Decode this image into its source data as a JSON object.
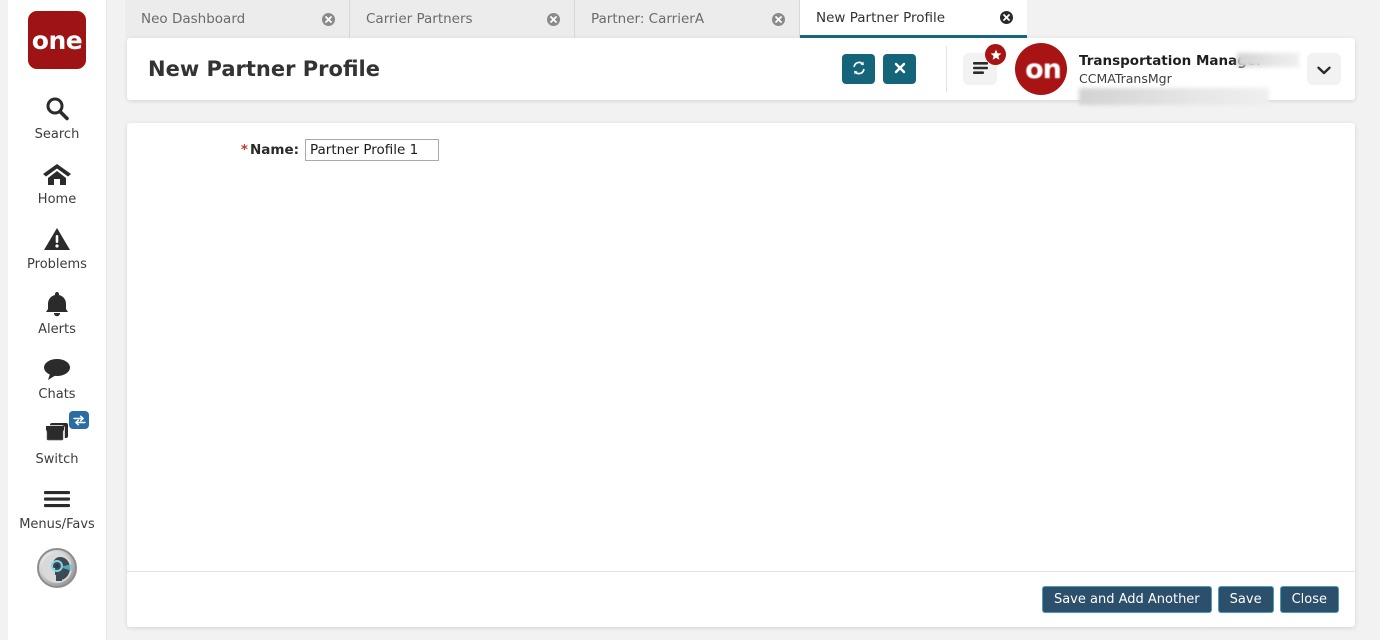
{
  "brand": {
    "logo_text": "one",
    "logo_color": "#9e1313",
    "accent_teal": "#15657a",
    "button_navy": "#2c4f6b",
    "button_border": "#49a0b5"
  },
  "sidebar": {
    "items": [
      {
        "label": "Search",
        "icon": "search-icon"
      },
      {
        "label": "Home",
        "icon": "home-icon"
      },
      {
        "label": "Problems",
        "icon": "warning-triangle-icon"
      },
      {
        "label": "Alerts",
        "icon": "bell-icon"
      },
      {
        "label": "Chats",
        "icon": "chat-bubble-icon"
      },
      {
        "label": "Switch",
        "icon": "windows-stack-icon",
        "badge_icon": "swap-arrows-icon"
      },
      {
        "label": "Menus/Favs",
        "icon": "hamburger-icon"
      }
    ],
    "assistant_icon": "ai-assistant-avatar-icon"
  },
  "tabs": [
    {
      "label": "Neo Dashboard",
      "active": false,
      "close_icon": "close-circle-icon"
    },
    {
      "label": "Carrier Partners",
      "active": false,
      "close_icon": "close-circle-icon"
    },
    {
      "label": "Partner: CarrierA",
      "active": false,
      "close_icon": "close-circle-icon"
    },
    {
      "label": "New Partner Profile",
      "active": true,
      "close_icon": "close-circle-icon"
    }
  ],
  "header": {
    "title": "New Partner Profile",
    "refresh_icon": "refresh-icon",
    "close_icon": "x-icon",
    "menu_icon": "hamburger-icon",
    "star_badge_icon": "star-icon",
    "avatar_icon": "one-logo-avatar",
    "avatar_text": "on",
    "user_role": "Transportation Manager",
    "user_name": "CCMATransMgr",
    "chevron_icon": "chevron-down-icon"
  },
  "form": {
    "name_label": "Name:",
    "required_marker": "*",
    "name_value": "Partner Profile 1",
    "name_placeholder": ""
  },
  "footer": {
    "save_and_add_another": "Save and Add Another",
    "save": "Save",
    "close": "Close"
  }
}
